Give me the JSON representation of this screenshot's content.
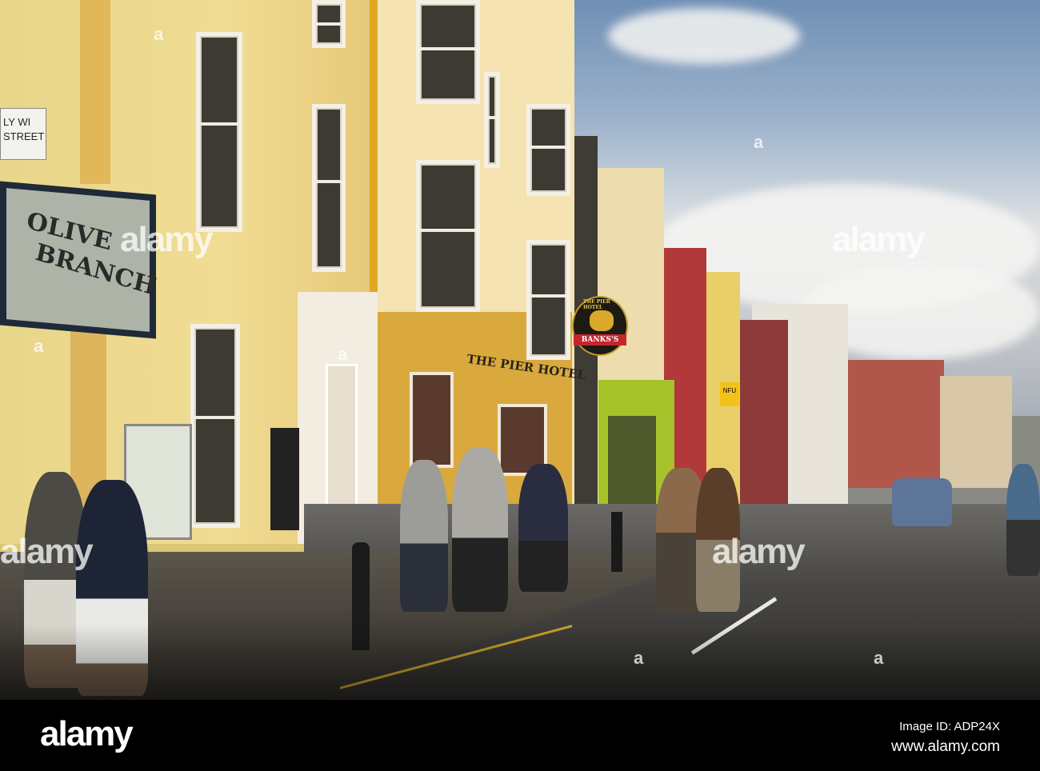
{
  "photo": {
    "street_sign": {
      "line1": "LY WI",
      "line2": "STREET"
    },
    "olive_branch_sign": {
      "line1": "OLIVE",
      "line2": "BRANCH"
    },
    "pier_hotel_sign": "THE PIER HOTEL",
    "hanging_sign": {
      "top": "THE PIER HOTEL",
      "banner": "BANKS'S"
    },
    "shop_sign_nfu": "NFU",
    "watermark": "alamy",
    "watermark_small": "a"
  },
  "footer": {
    "logo": "alamy",
    "image_id": "Image ID: ADP24X",
    "url": "www.alamy.com"
  },
  "colors": {
    "facade_yellow": "#e9d98a",
    "facade_cream": "#f3dfa8",
    "hotel_ochre": "#d9a93e",
    "sky": "#9fb4cc",
    "footer_bg": "#000000"
  }
}
